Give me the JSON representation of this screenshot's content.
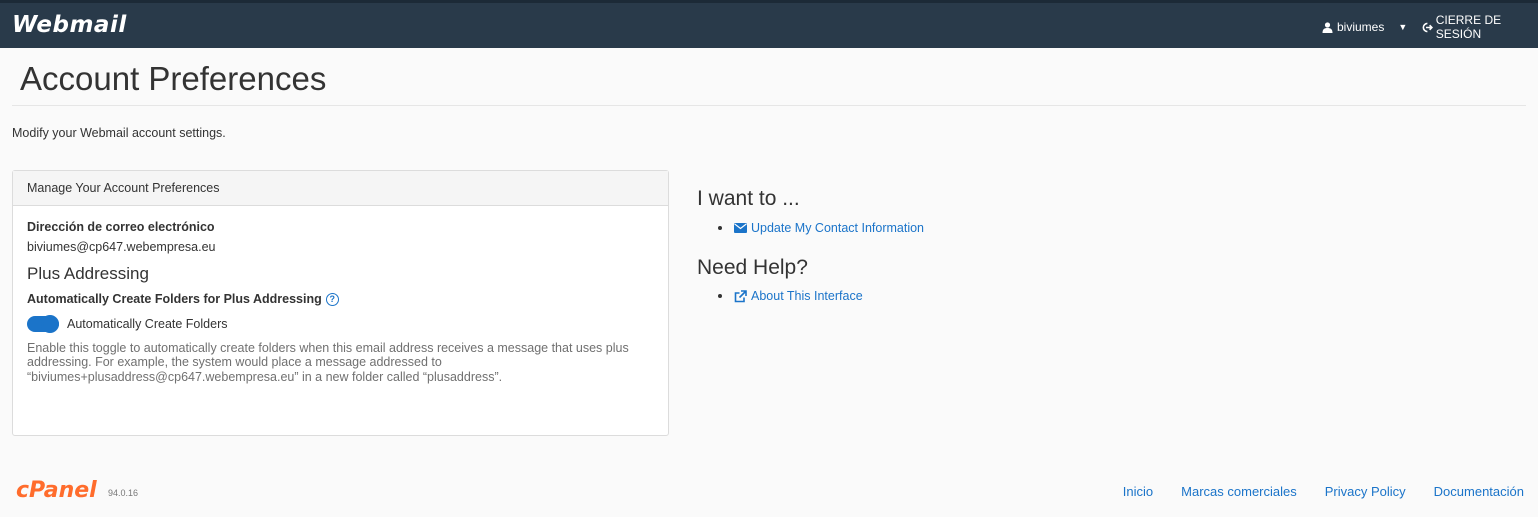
{
  "header": {
    "brand": "Webmail",
    "user": "biviumes",
    "user_icon": "user-icon",
    "logout_label": "CIERRE DE SESIÓN",
    "logout_icon": "sign-out-icon"
  },
  "page": {
    "title": "Account Preferences",
    "subtitle": "Modify your Webmail account settings."
  },
  "panel": {
    "heading": "Manage Your Account Preferences",
    "email_label": "Dirección de correo electrónico",
    "email_value": "biviumes@cp647.webempresa.eu",
    "plus_title": "Plus Addressing",
    "toggle_heading": "Automatically Create Folders for Plus Addressing",
    "toggle_label": "Automatically Create Folders",
    "toggle_on": true,
    "help_text": "Enable this toggle to automatically create folders when this email address receives a message that uses plus addressing. For example, the system would place a message addressed to “biviumes+plusaddress@cp647.webempresa.eu” in a new folder called “plusaddress”."
  },
  "sidebar": {
    "i_want_to": "I want to ...",
    "update_link": "Update My Contact Information",
    "need_help": "Need Help?",
    "about_link": "About This Interface"
  },
  "footer": {
    "logo": "cPanel",
    "version": "94.0.16",
    "links": [
      "Inicio",
      "Marcas comerciales",
      "Privacy Policy",
      "Documentación"
    ]
  },
  "colors": {
    "topbar": "#293a4a",
    "link": "#1b74c9",
    "cpanel_orange": "#ff6c2c"
  }
}
